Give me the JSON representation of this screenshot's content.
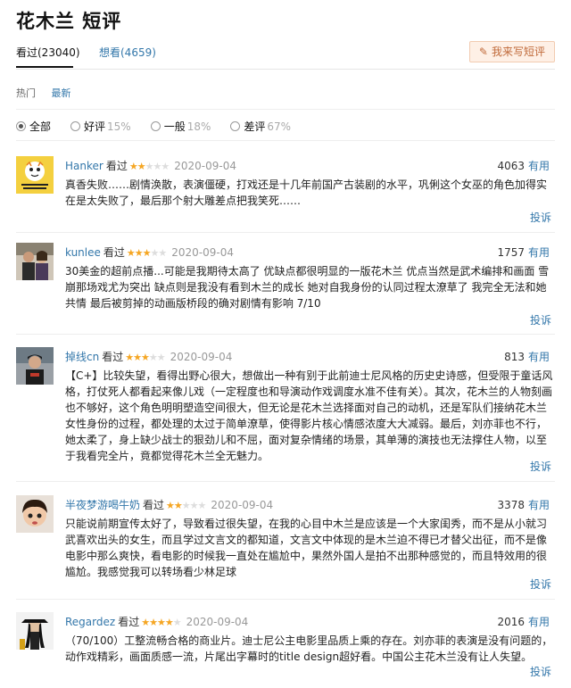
{
  "page": {
    "title": "花木兰 短评"
  },
  "tabs": {
    "watched": "看过(23040)",
    "want": "想看(4659)",
    "write_button": "我来写短评"
  },
  "sort": {
    "hot": "热门",
    "latest": "最新"
  },
  "filters": {
    "all": "全部",
    "good": "好评",
    "good_pct": "15%",
    "normal": "一般",
    "normal_pct": "18%",
    "bad": "差评",
    "bad_pct": "67%"
  },
  "reviews": [
    {
      "user": "Hanker",
      "status": "看过",
      "rating": 2,
      "date": "2020-09-04",
      "votes": "4063",
      "useful": "有用",
      "text": "真香失败……剧情涣散，表演僵硬，打戏还是十几年前国产古装剧的水平，巩俐这个女巫的角色加得实在是太失败了，最后那个射大雕差点把我笑死……",
      "report": "投诉"
    },
    {
      "user": "kunlee",
      "status": "看过",
      "rating": 3,
      "date": "2020-09-04",
      "votes": "1757",
      "useful": "有用",
      "text": "30美金的超前点播...可能是我期待太高了 优缺点都很明显的一版花木兰 优点当然是武术编排和画面 雪崩那场戏尤为突出 缺点则是我没有看到木兰的成长 她对自我身份的认同过程太潦草了 我完全无法和她共情 最后被剪掉的动画版桥段的确对剧情有影响 7/10",
      "report": "投诉"
    },
    {
      "user": "掉线cn",
      "status": "看过",
      "rating": 3,
      "date": "2020-09-04",
      "votes": "813",
      "useful": "有用",
      "text": "【C+】比较失望，看得出野心很大，想做出一种有别于此前迪士尼风格的历史史诗感，但受限于童话风格，打仗死人都看起来像儿戏（一定程度也和导演动作戏调度水准不佳有关）。其次，花木兰的人物刻画也不够好，这个角色明明塑造空间很大，但无论是花木兰选择面对自己的动机，还是军队们接纳花木兰女性身份的过程，都处理的太过于简单潦草，使得影片核心情感浓度大大减弱。最后，刘亦菲也不行，她太柔了，身上缺少战士的狠劲儿和不屈，面对复杂情绪的场景，其单薄的演技也无法撑住人物，以至于我看完全片，竟都觉得花木兰全无魅力。",
      "report": "投诉"
    },
    {
      "user": "半夜梦游喝牛奶",
      "status": "看过",
      "rating": 2,
      "date": "2020-09-04",
      "votes": "3378",
      "useful": "有用",
      "text": "只能说前期宣传太好了，导致看过很失望，在我的心目中木兰是应该是一个大家闺秀，而不是从小就习武喜欢出头的女生，而且学过文言文的都知道，文言文中体现的是木兰迫不得已才替父出征，而不是像电影中那么爽快，看电影的时候我一直处在尴尬中，果然外国人是拍不出那种感觉的，而且特效用的很尴尬。我感觉我可以转场看少林足球",
      "report": "投诉"
    },
    {
      "user": "Regardez",
      "status": "看过",
      "rating": 4,
      "date": "2020-09-04",
      "votes": "2016",
      "useful": "有用",
      "text": "（70/100）工整流畅合格的商业片。迪士尼公主电影里品质上乘的存在。刘亦菲的表演是没有问题的，动作戏精彩，画面质感一流，片尾出字幕时的title design超好看。中国公主花木兰没有让人失望。",
      "report": "投诉"
    }
  ],
  "colors": {
    "link": "#3377aa",
    "star": "#f5a623",
    "write_button_bg": "#fef0e6"
  }
}
